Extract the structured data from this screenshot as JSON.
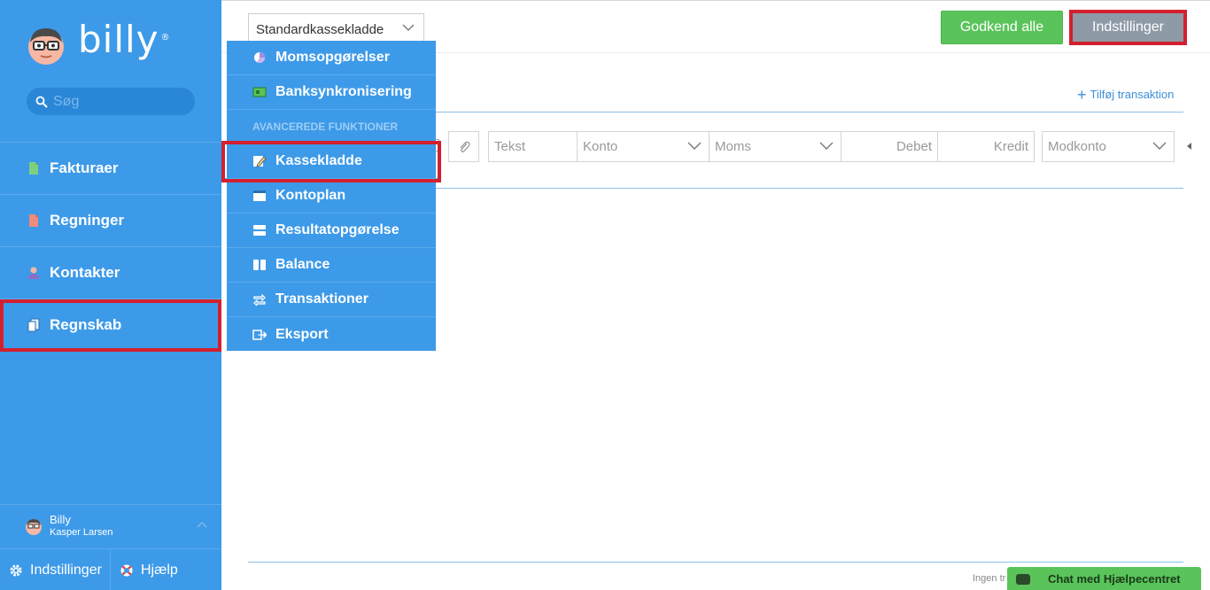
{
  "sidebar": {
    "logo_text": "billy",
    "logo_reg": "®",
    "search_placeholder": "Søg",
    "items": [
      {
        "label": "Fakturaer",
        "icon": "invoice-icon"
      },
      {
        "label": "Regninger",
        "icon": "bill-icon"
      },
      {
        "label": "Kontakter",
        "icon": "contact-icon"
      },
      {
        "label": "Regnskab",
        "icon": "accounting-icon"
      }
    ],
    "user": {
      "name": "Billy",
      "sub": "Kasper Larsen"
    },
    "bottom": {
      "settings": "Indstillinger",
      "help": "Hjælp"
    }
  },
  "header": {
    "kladde_select": "Standardkassekladde",
    "approve_all": "Godkend alle",
    "settings": "Indstillinger"
  },
  "journal": {
    "add_transaction": "Tilføj transaktion",
    "fields": {
      "text": "Tekst",
      "account": "Konto",
      "vat": "Moms",
      "debit": "Debet",
      "credit": "Kredit",
      "counter_account": "Modkonto"
    }
  },
  "dropdown": {
    "items_top": [
      {
        "label": "Momsopgørelser",
        "icon": "pie-chart-icon"
      },
      {
        "label": "Banksynkronisering",
        "icon": "bank-icon"
      }
    ],
    "section_header": "AVANCEREDE FUNKTIONER",
    "items_advanced": [
      {
        "label": "Kassekladde",
        "icon": "edit-icon"
      },
      {
        "label": "Kontoplan",
        "icon": "chart-of-accounts-icon"
      },
      {
        "label": "Resultatopgørelse",
        "icon": "income-statement-icon"
      },
      {
        "label": "Balance",
        "icon": "balance-icon"
      },
      {
        "label": "Transaktioner",
        "icon": "transactions-icon"
      },
      {
        "label": "Eksport",
        "icon": "export-icon"
      }
    ]
  },
  "footer": {
    "text": "Ingen tr",
    "chat": "Chat med Hjælpecentret"
  },
  "colors": {
    "sidebar": "#3d9ae8",
    "approve": "#5ac45a",
    "settings_btn": "#8e9aa6",
    "highlight": "#d3202f"
  }
}
